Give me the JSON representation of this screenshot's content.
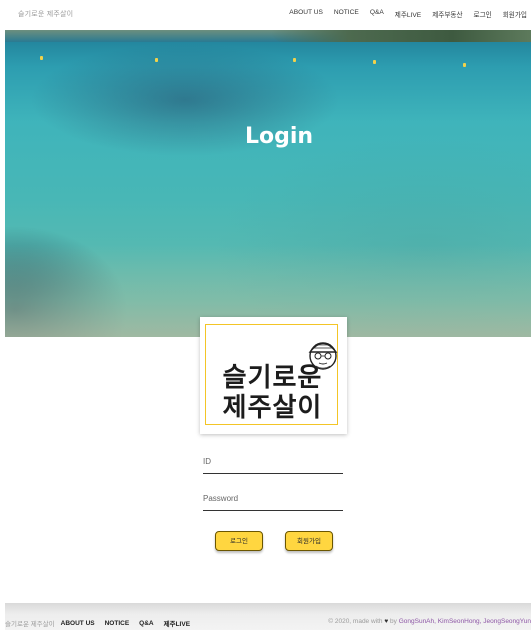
{
  "nav": {
    "brand": "슬기로운 제주살이",
    "links": [
      "ABOUT US",
      "NOTICE",
      "Q&A",
      "제주LIVE",
      "제주부동산",
      "로그인",
      "회원가입"
    ]
  },
  "hero": {
    "title": "Login"
  },
  "logo": {
    "line1": "슬기로운",
    "line2": "제주살이",
    "border_color": "#f3c526"
  },
  "form": {
    "id_placeholder": "ID",
    "password_placeholder": "Password",
    "login_button": "로그인",
    "signup_button": "회원가입",
    "button_color": "#ffd640"
  },
  "footer": {
    "brand": "슬기로운 제주살이",
    "links": [
      "ABOUT US",
      "NOTICE",
      "Q&A",
      "제주LIVE"
    ],
    "copyright_prefix": "© 2020, made with",
    "heart_icon": "heart-icon",
    "by_text": "by",
    "authors": "GongSunAh, KimSeonHong, JeongSeongYun"
  }
}
